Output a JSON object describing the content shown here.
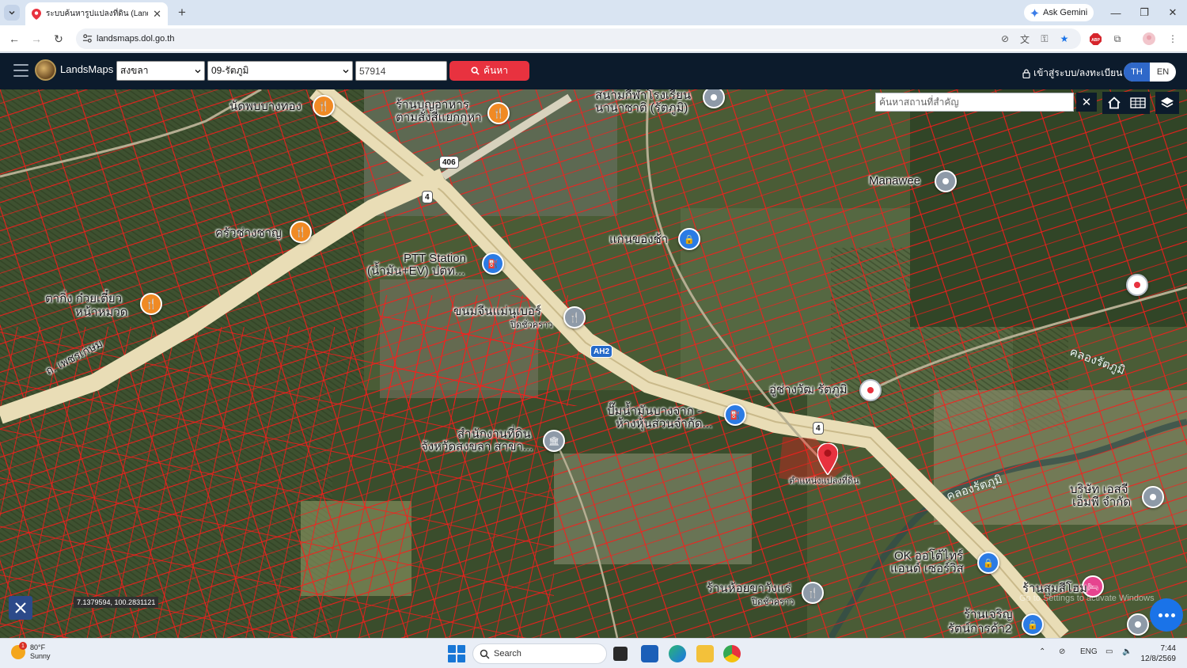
{
  "browser": {
    "tab_title": "ระบบค้นหารูปแปลงที่ดิน (LandsMaps)",
    "url": "landsmaps.dol.go.th",
    "gemini_label": "Ask Gemini",
    "abp_label": "ABP"
  },
  "header": {
    "brand": "LandsMaps",
    "province": "สงขลา",
    "district": "09-รัตภูมิ",
    "parcel_no": "57914",
    "search_label": "ค้นหา",
    "login_label": "เข้าสู่ระบบ/ลงทะเบียน",
    "lang_th": "TH",
    "lang_en": "EN"
  },
  "map": {
    "search_placeholder": "ค้นหาสถานที่สำคัญ",
    "coords": "7.1379594, 100.2831121",
    "watermark": "Go to Settings to activate Windows",
    "roads": {
      "r406": "406",
      "r4a": "4",
      "r4b": "4",
      "ah2": "AH2",
      "phetkasem": "ถ. เพชรเกษม"
    },
    "places": [
      {
        "name": "นัดพบบางทอง"
      },
      {
        "name": "ร้านบุญอาหาร ตามสั่งสี่แยกกูหา"
      },
      {
        "name": "สนามกีฬาโรงเรียน นานาชาติ (รัตภูมิ)"
      },
      {
        "name": "Manawee"
      },
      {
        "name": "ครัวช่างชาญ"
      },
      {
        "name": "แกนของช้า"
      },
      {
        "name": "PTT Station",
        "sub": "(น้ำมัน+EV) ปตท..."
      },
      {
        "name": "ตากิ่ง ก๋วยเตี๋ยว",
        "sub": "หน้าหมวด"
      },
      {
        "name": "ขนมจีนแม่นุเบอร์",
        "sub": "ปิดชั่วคราว"
      },
      {
        "name": "อู่ช่างวัฒ รัตภูมิ"
      },
      {
        "name": "คลองรัตภูมิ"
      },
      {
        "name": "ปั๊มน้ำมันบางจาก -",
        "sub": "ห้างหุ้นส่วนจำกัด..."
      },
      {
        "name": "สำนักงานที่ดิน",
        "sub": "จังหวัดสงขลา สาขา..."
      },
      {
        "name": "ตำแหน่งแปลงที่ดิน"
      },
      {
        "name": "คลองรัตภูมิ"
      },
      {
        "name": "บริษัท เอสจี",
        "sub": "เอ็มพี จำกัด"
      },
      {
        "name": "OK ออโต้ไทร์",
        "sub": "แอนด์ เซอร์วิส"
      },
      {
        "name": "ร้านห้อยขาวังแร่",
        "sub": "ปิดชั่วคราว"
      },
      {
        "name": "ร้านสุมสีโฮม"
      },
      {
        "name": "ร้านเจริญ",
        "sub": "รัตน์การค้า2"
      }
    ]
  },
  "taskbar": {
    "weather_temp": "80°F",
    "weather_cond": "Sunny",
    "weather_badge": "1",
    "search_label": "Search",
    "lang": "ENG",
    "time": "7:44",
    "date": "12/8/2569"
  }
}
